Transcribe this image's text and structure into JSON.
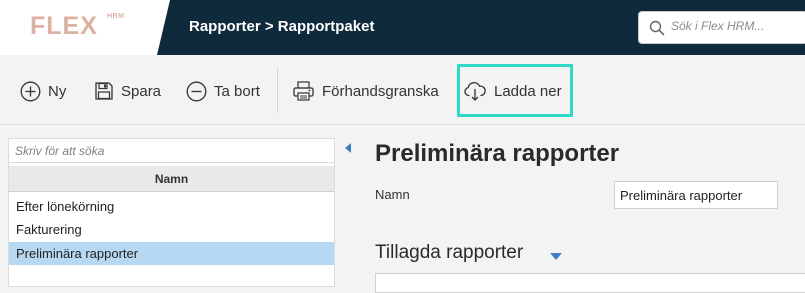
{
  "header": {
    "logo_text": "FLEX",
    "logo_sup": "HRM",
    "breadcrumb": "Rapporter > Rapportpaket",
    "search_placeholder": "Sök i Flex HRM..."
  },
  "toolbar": {
    "new_label": "Ny",
    "save_label": "Spara",
    "delete_label": "Ta bort",
    "preview_label": "Förhandsgranska",
    "download_label": "Ladda ner"
  },
  "left_panel": {
    "filter_placeholder": "Skriv för att söka",
    "column_header": "Namn",
    "items": [
      {
        "label": "Efter lönekörning"
      },
      {
        "label": "Fakturering"
      },
      {
        "label": "Preliminära rapporter"
      }
    ],
    "selected_index": 2
  },
  "main": {
    "title": "Preliminära rapporter",
    "name_label": "Namn",
    "name_value": "Preliminära rapporter",
    "section_title": "Tillagda rapporter"
  },
  "colors": {
    "header_bg": "#0f2b3b",
    "logo": "#dcb1a2",
    "highlight": "#2edac6",
    "selected_row": "#b7d8f2",
    "accent": "#3f7fc1"
  }
}
